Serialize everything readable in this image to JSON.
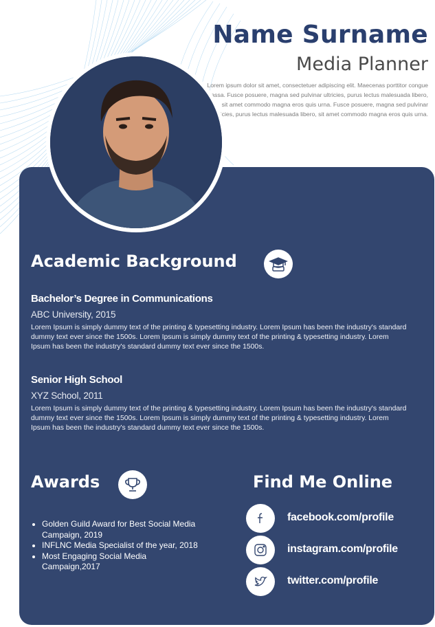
{
  "header": {
    "name": "Name Surname",
    "title": "Media Planner",
    "intro": "Lorem ipsum dolor sit amet, consectetuer adipiscing elit. Maecenas porttitor congue massa. Fusce posuere, magna sed pulvinar ultricies, purus lectus malesuada libero, sit amet commodo magna eros quis urna. Fusce posuere, magna sed pulvinar ultricies, purus lectus malesuada libero, sit amet commodo magna eros quis urna."
  },
  "academic": {
    "title": "Academic Background",
    "icon": "graduation-cap-icon",
    "entries": [
      {
        "degree": "Bachelor’s Degree in Communications",
        "school": "ABC University, 2015",
        "description": "Lorem Ipsum is simply dummy text of the printing & typesetting industry. Lorem Ipsum has been the industry's standard dummy text ever since the 1500s. Lorem Ipsum is simply dummy text of the printing & typesetting industry. Lorem Ipsum has been the industry's standard dummy text ever since the 1500s."
      },
      {
        "degree": "Senior High School",
        "school": "XYZ School, 2011",
        "description": "Lorem Ipsum is simply dummy text of the printing & typesetting industry. Lorem Ipsum has been the industry's standard dummy text ever since the 1500s. Lorem Ipsum is simply dummy text of the printing & typesetting industry. Lorem Ipsum has been the industry's standard dummy text ever since the 1500s."
      }
    ]
  },
  "awards": {
    "title": "Awards",
    "icon": "trophy-icon",
    "items": [
      "Golden Guild Award for Best Social Media Campaign, 2019",
      "INFLNC Media Specialist of the year, 2018",
      "Most Engaging Social Media Campaign,2017"
    ]
  },
  "online": {
    "title": "Find Me Online",
    "links": [
      {
        "icon": "facebook-icon",
        "text": "facebook.com/profile"
      },
      {
        "icon": "instagram-icon",
        "text": "instagram.com/profile"
      },
      {
        "icon": "twitter-icon",
        "text": "twitter.com/profile"
      }
    ]
  },
  "colors": {
    "panel": "#33466f",
    "name": "#2a3f6e",
    "accent_lines": "#a9d3ef"
  }
}
